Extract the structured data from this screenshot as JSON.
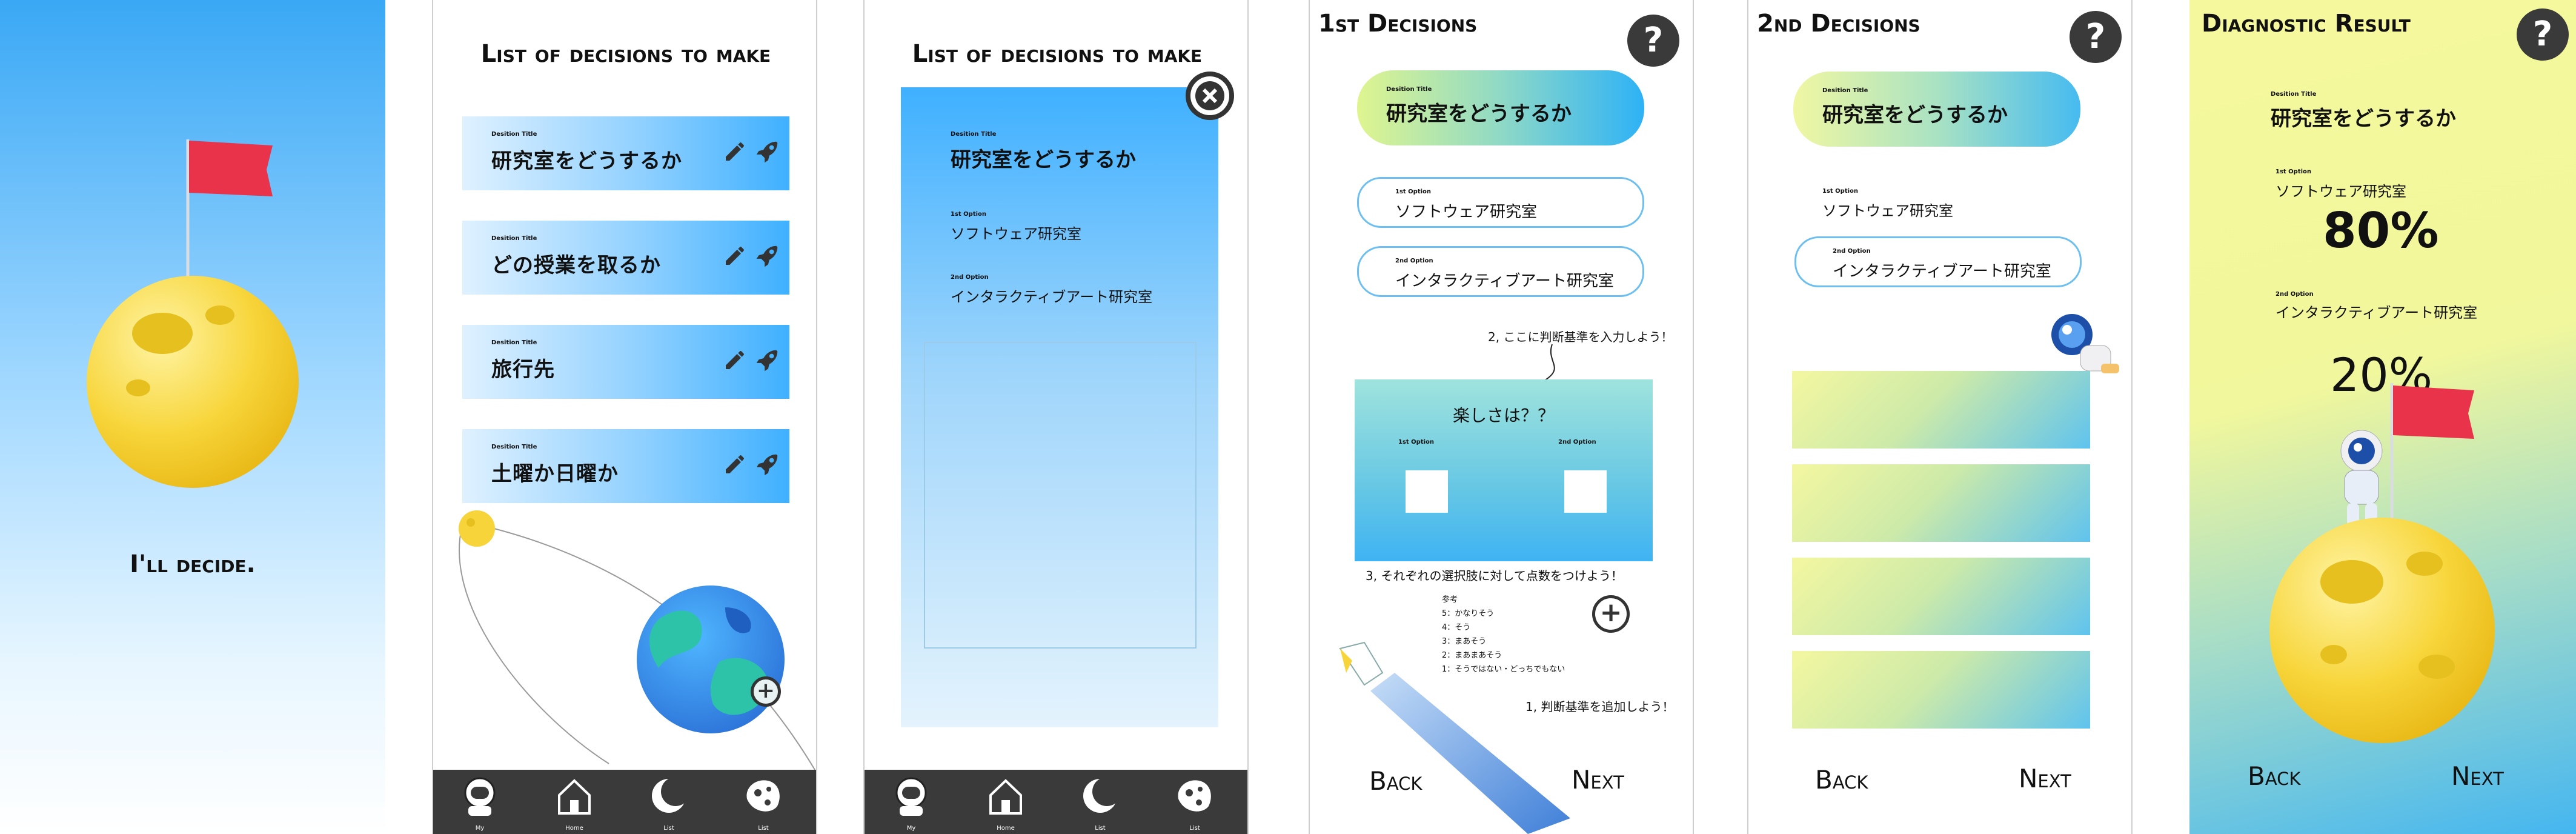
{
  "screen1": {
    "tagline": "I'll decide."
  },
  "screen2": {
    "title": "List of decisions to make",
    "card_label": "Desition Title",
    "items": [
      {
        "title": "研究室をどうするか"
      },
      {
        "title": "どの授業を取るか"
      },
      {
        "title": "旅行先"
      },
      {
        "title": "土曜か日曜か"
      }
    ]
  },
  "nav": [
    {
      "label": "My",
      "icon": "astronaut-icon"
    },
    {
      "label": "Home",
      "icon": "home-icon"
    },
    {
      "label": "List",
      "icon": "moon-icon"
    },
    {
      "label": "List",
      "icon": "asteroid-icon"
    }
  ],
  "screen3": {
    "title": "List of decisions to make",
    "title_label": "Desition Title",
    "title_value": "研究室をどうするか",
    "opt1_label": "1st Option",
    "opt1_value": "ソフトウェア研究室",
    "opt2_label": "2nd Option",
    "opt2_value": "インタラクティブアート研究室"
  },
  "screen4": {
    "title": "1st Decisions",
    "help": "?",
    "title_label": "Desition Title",
    "title_value": "研究室をどうするか",
    "opt1_label": "1st Option",
    "opt1_value": "ソフトウェア研究室",
    "opt2_label": "2nd Option",
    "opt2_value": "インタラクティブアート研究室",
    "hint2": "2, ここに判断基準を入力しよう！",
    "criterion": "楽しさは？？",
    "col1": "1st Option",
    "col2": "2nd Option",
    "hint3": "3, それぞれの選択肢に対して点数をつけよう！",
    "ref_title": "参考",
    "ref_lines": [
      "5：かなりそう",
      "4：そう",
      "3：まあそう",
      "2：まあまあそう",
      "1：そうではない・どっちでもない"
    ],
    "hint1": "1, 判断基準を追加しよう！",
    "back": "Back",
    "next": "Next"
  },
  "screen5": {
    "title": "2nd Decisions",
    "help": "?",
    "title_label": "Desition Title",
    "title_value": "研究室をどうするか",
    "opt1_label": "1st Option",
    "opt1_value": "ソフトウェア研究室",
    "opt2_label": "2nd Option",
    "opt2_value": "インタラクティブアート研究室",
    "back": "Back",
    "next": "Next"
  },
  "screen6": {
    "title": "Diagnostic Result",
    "help": "?",
    "title_label": "Desition Title",
    "title_value": "研究室をどうするか",
    "opt1_label": "1st Option",
    "opt1_value": "ソフトウェア研究室",
    "opt1_percent": "80%",
    "opt2_label": "2nd Option",
    "opt2_value": "インタラクティブアート研究室",
    "opt2_percent": "20%",
    "back": "Back",
    "next": "Next"
  },
  "colors": {
    "accent_blue": "#3fb0ff",
    "nav_dark": "#3a3a3a",
    "flag_red": "#e8334a",
    "moon_yellow": "#f7d53a",
    "result_yellow": "#f4f79a"
  }
}
